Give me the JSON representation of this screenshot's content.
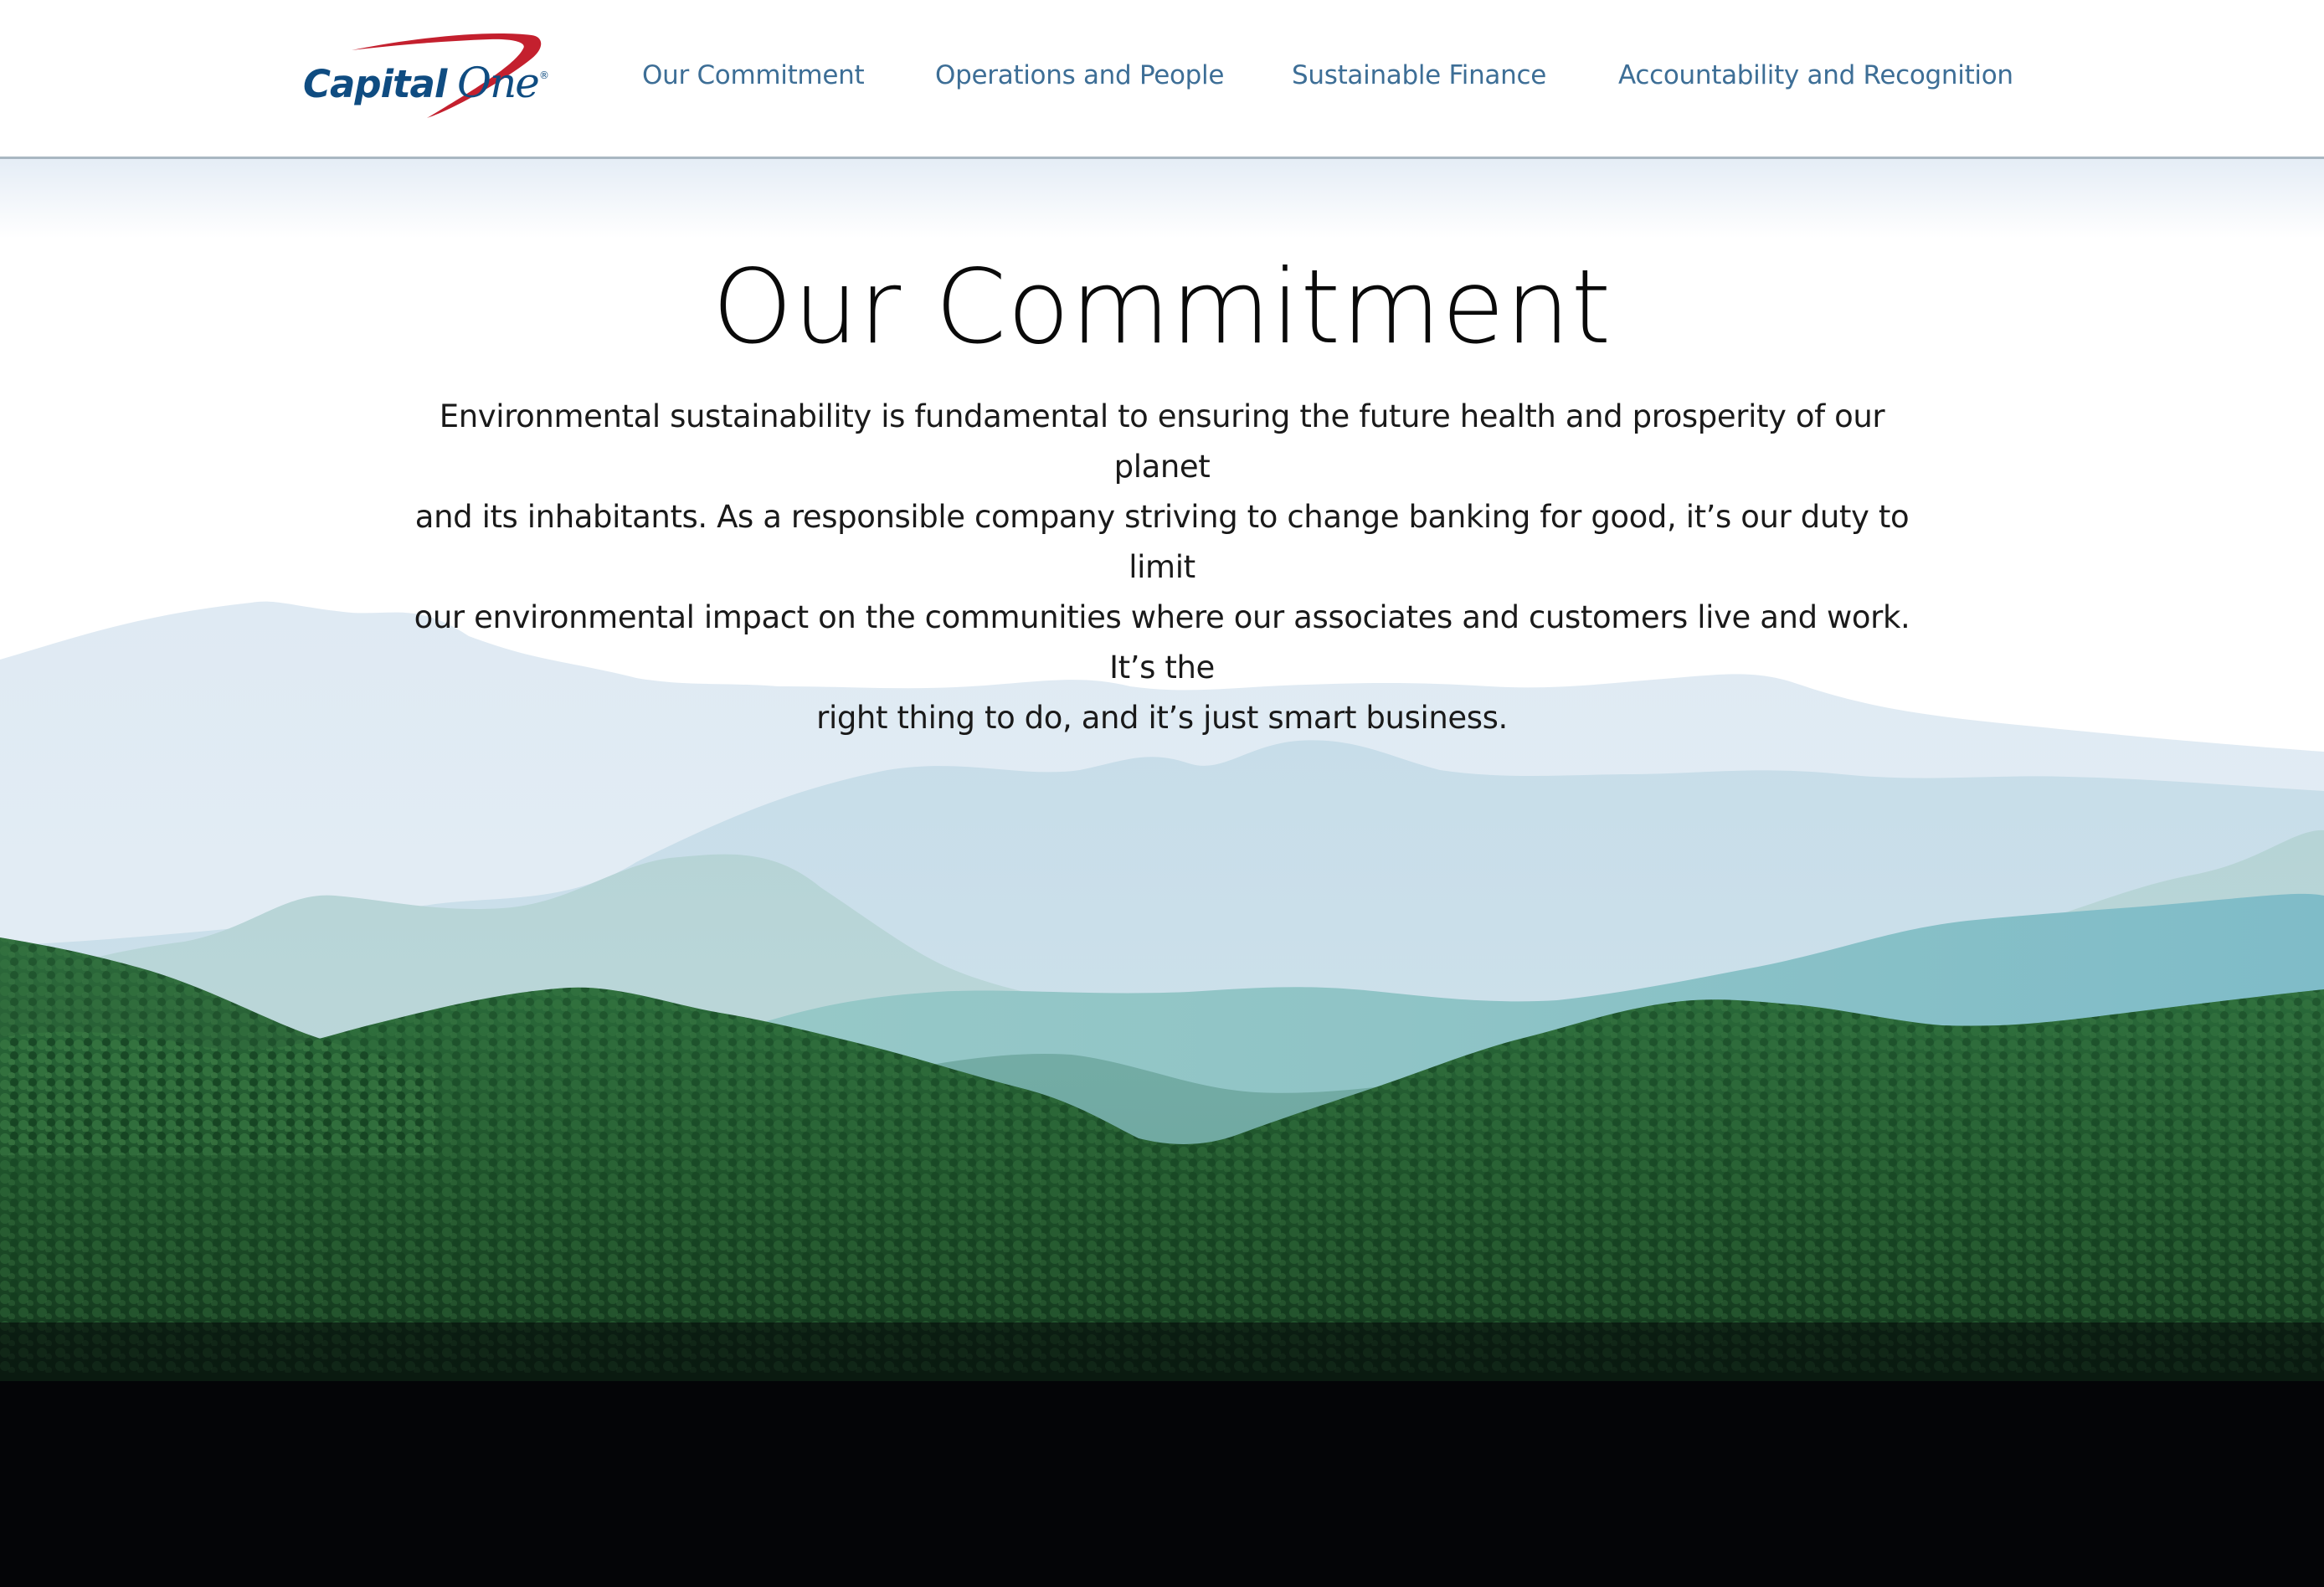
{
  "brand": {
    "name": "Capital One",
    "logo_text_primary": "Capital",
    "logo_text_secondary": "One",
    "registered_mark": "®",
    "colors": {
      "navy": "#0f4c81",
      "red": "#c4202e"
    }
  },
  "nav": {
    "items": [
      {
        "label": "Our Commitment"
      },
      {
        "label": "Operations and People"
      },
      {
        "label": "Sustainable Finance"
      },
      {
        "label": "Accountability and Recognition"
      }
    ],
    "link_color": "#3d6e96"
  },
  "hero": {
    "title": "Our Commitment",
    "body_lines": [
      "Environmental sustainability is fundamental to ensuring the future health and prosperity of our planet",
      "and its inhabitants. As a responsible company striving to change banking for good, it’s our duty to limit",
      "our environmental impact on the communities where our associates and customers live and work. It’s the",
      "right thing to do, and it’s just smart business."
    ]
  },
  "image": {
    "subject": "misty forested mountain ranges",
    "icon": "mountain-landscape-image"
  }
}
